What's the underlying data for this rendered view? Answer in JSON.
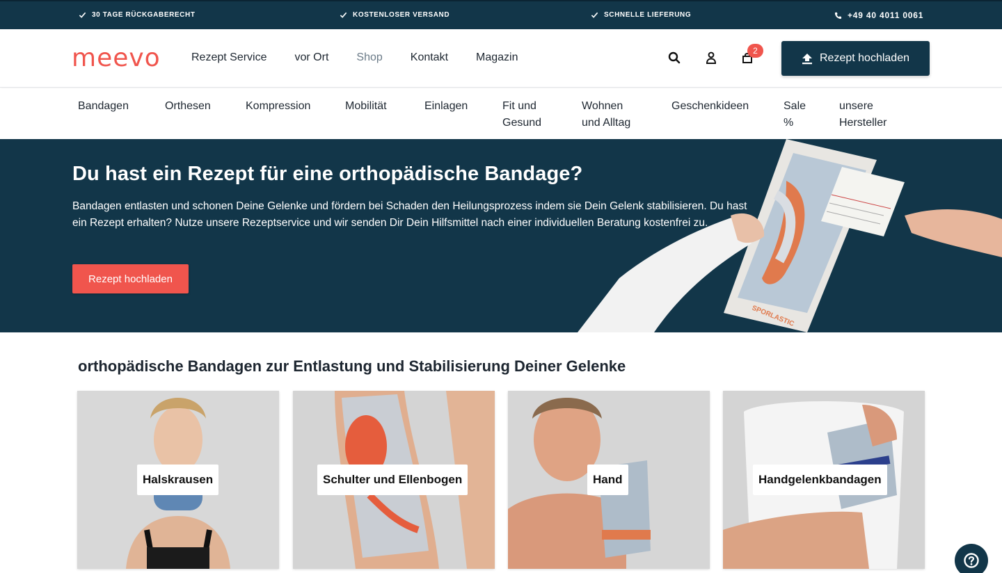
{
  "topbar": {
    "returns": "30 TAGE RÜCKGABERECHT",
    "shipping": "KOSTENLOSER VERSAND",
    "delivery": "SCHNELLE LIEFERUNG",
    "phone": "+49 40 4011 0061"
  },
  "header": {
    "logo": "meevo",
    "nav": [
      "Rezept Service",
      "vor Ort",
      "Shop",
      "Kontakt",
      "Magazin"
    ],
    "active_nav": "Shop",
    "cart_count": "2",
    "upload_label": "Rezept hochladen"
  },
  "categories": {
    "c1": "Bandagen",
    "c2": "Orthesen",
    "c3": "Kompression",
    "c4": "Mobilität",
    "c5": "Einlagen",
    "c6a": "Fit und",
    "c6b": "Gesund",
    "c7a": "Wohnen",
    "c7b": "und Alltag",
    "c8": "Geschenkideen",
    "c9a": "Sale",
    "c9b": "%",
    "c10a": "unsere",
    "c10b": "Hersteller"
  },
  "hero": {
    "title": "Du hast ein Rezept für eine orthopädische Bandage?",
    "text": "Bandagen entlasten und schonen Deine Gelenke und fördern bei Schaden den Heilungsprozess indem sie Dein Gelenk stabilisieren. Du hast ein Rezept erhalten? Nutze unsere Rezeptservice und wir senden Dir Dein Hilfsmittel nach einer individuellen Beratung kostenfrei zu.",
    "cta": "Rezept hochladen",
    "box_brand": "SPORLASTIC"
  },
  "section": {
    "title": "orthopädische Bandagen zur Entlastung und Stabilisierung Deiner Gelenke",
    "cards": [
      "Halskrausen",
      "Schulter und Ellenbogen",
      "Hand",
      "Handgelenkbandagen"
    ]
  },
  "colors": {
    "navy": "#123649",
    "accent": "#f0554d"
  }
}
